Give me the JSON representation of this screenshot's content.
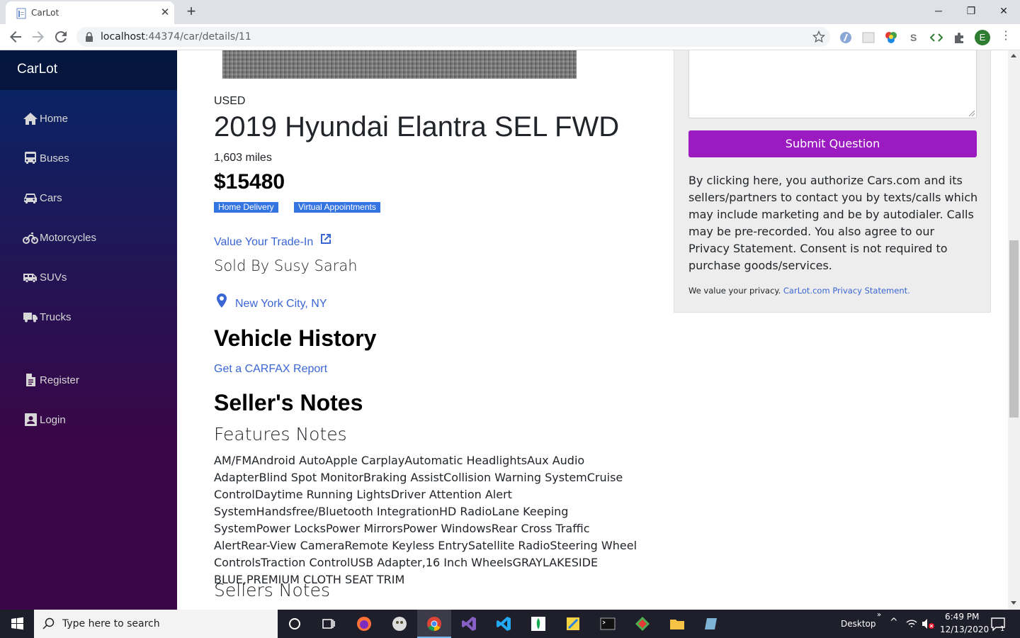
{
  "browser": {
    "tab_title": "CarLot",
    "url_host": "localhost",
    "url_rest": ":44374/car/details/11",
    "profile_initial": "E"
  },
  "sidebar": {
    "brand": "CarLot",
    "items": [
      {
        "label": "Home",
        "icon": "home-icon"
      },
      {
        "label": "Buses",
        "icon": "bus-icon"
      },
      {
        "label": "Cars",
        "icon": "car-icon"
      },
      {
        "label": "Motorcycles",
        "icon": "motorcycle-icon"
      },
      {
        "label": "SUVs",
        "icon": "shuttle-van-icon"
      },
      {
        "label": "Trucks",
        "icon": "truck-icon"
      },
      {
        "label": "Register",
        "icon": "document-icon"
      },
      {
        "label": "Login",
        "icon": "user-icon"
      }
    ]
  },
  "car": {
    "condition": "USED",
    "title": "2019 Hyundai Elantra SEL FWD",
    "miles": "1,603 miles",
    "price": "$15480",
    "badges": [
      "Home Delivery",
      "Virtual Appointments"
    ],
    "trade_in_link": "Value Your Trade-In",
    "sold_by": "Sold By Susy Sarah",
    "location": "New York City, NY",
    "history_heading": "Vehicle History",
    "carfax_link": "Get a CARFAX Report",
    "notes_heading": "Seller's Notes",
    "features_heading": "Features Notes",
    "features_text": "AM/FMAndroid AutoApple CarplayAutomatic HeadlightsAux Audio AdapterBlind Spot MonitorBraking AssistCollision Warning SystemCruise ControlDaytime Running LightsDriver Attention Alert SystemHandsfree/Bluetooth IntegrationHD RadioLane Keeping SystemPower LocksPower MirrorsPower WindowsRear Cross Traffic AlertRear-View CameraRemote Keyless EntrySatellite RadioSteering Wheel ControlsTraction ControlUSB Adapter,16 Inch WheelsGRAYLAKESIDE BLUE,PREMIUM CLOTH SEAT TRIM",
    "sellers_notes_heading": "Sellers Notes"
  },
  "contact_panel": {
    "submit_label": "Submit Question",
    "consent_text": "By clicking here, you authorize Cars.com and its sellers/partners to contact you by texts/calls which may include marketing and be by autodialer. Calls may be pre-recorded. You also agree to our Privacy Statement. Consent is not required to purchase goods/services.",
    "privacy_prefix": "We value your privacy.",
    "privacy_link": "CarLot.com Privacy Statement."
  },
  "taskbar": {
    "search_placeholder": "Type here to search",
    "desktop_label": "Desktop",
    "time": "6:49 PM",
    "date": "12/13/2020",
    "notification_count": "1"
  },
  "colors": {
    "accent_purple": "#9b1bc1",
    "link_blue": "#3a66d4",
    "badge_blue": "#3474e0"
  }
}
